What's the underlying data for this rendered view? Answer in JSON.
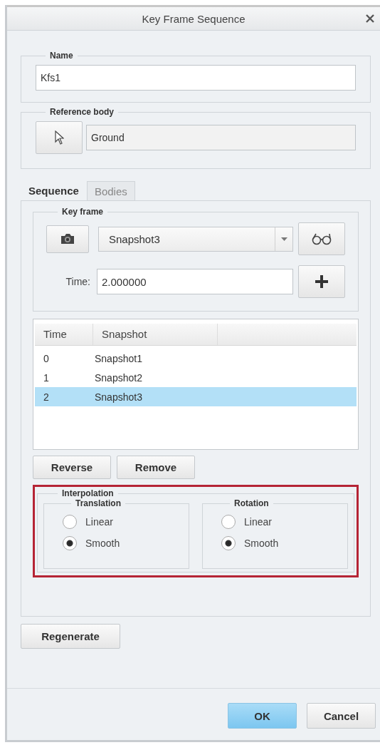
{
  "window": {
    "title": "Key Frame Sequence"
  },
  "name": {
    "label": "Name",
    "value": "Kfs1"
  },
  "reference_body": {
    "label": "Reference body",
    "value": "Ground"
  },
  "tabs": [
    {
      "label": "Sequence",
      "selected": true
    },
    {
      "label": "Bodies",
      "selected": false
    }
  ],
  "key_frame": {
    "label": "Key frame",
    "snapshot": "Snapshot3",
    "time_label": "Time:",
    "time_value": "2.000000"
  },
  "table": {
    "columns": [
      "Time",
      "Snapshot"
    ],
    "rows": [
      {
        "cells": [
          "0",
          "Snapshot1"
        ],
        "selected": false
      },
      {
        "cells": [
          "1",
          "Snapshot2"
        ],
        "selected": false
      },
      {
        "cells": [
          "2",
          "Snapshot3"
        ],
        "selected": true
      }
    ]
  },
  "list_buttons": [
    "Reverse",
    "Remove"
  ],
  "interpolation": {
    "label": "Interpolation",
    "highlighted": true,
    "groups": [
      {
        "label": "Translation",
        "options": [
          {
            "label": "Linear",
            "selected": false
          },
          {
            "label": "Smooth",
            "selected": true
          }
        ]
      },
      {
        "label": "Rotation",
        "options": [
          {
            "label": "Linear",
            "selected": false
          },
          {
            "label": "Smooth",
            "selected": true
          }
        ]
      }
    ]
  },
  "regenerate": "Regenerate",
  "buttons": [
    {
      "label": "OK",
      "kind": "primary"
    },
    {
      "label": "Cancel",
      "kind": "default"
    }
  ]
}
